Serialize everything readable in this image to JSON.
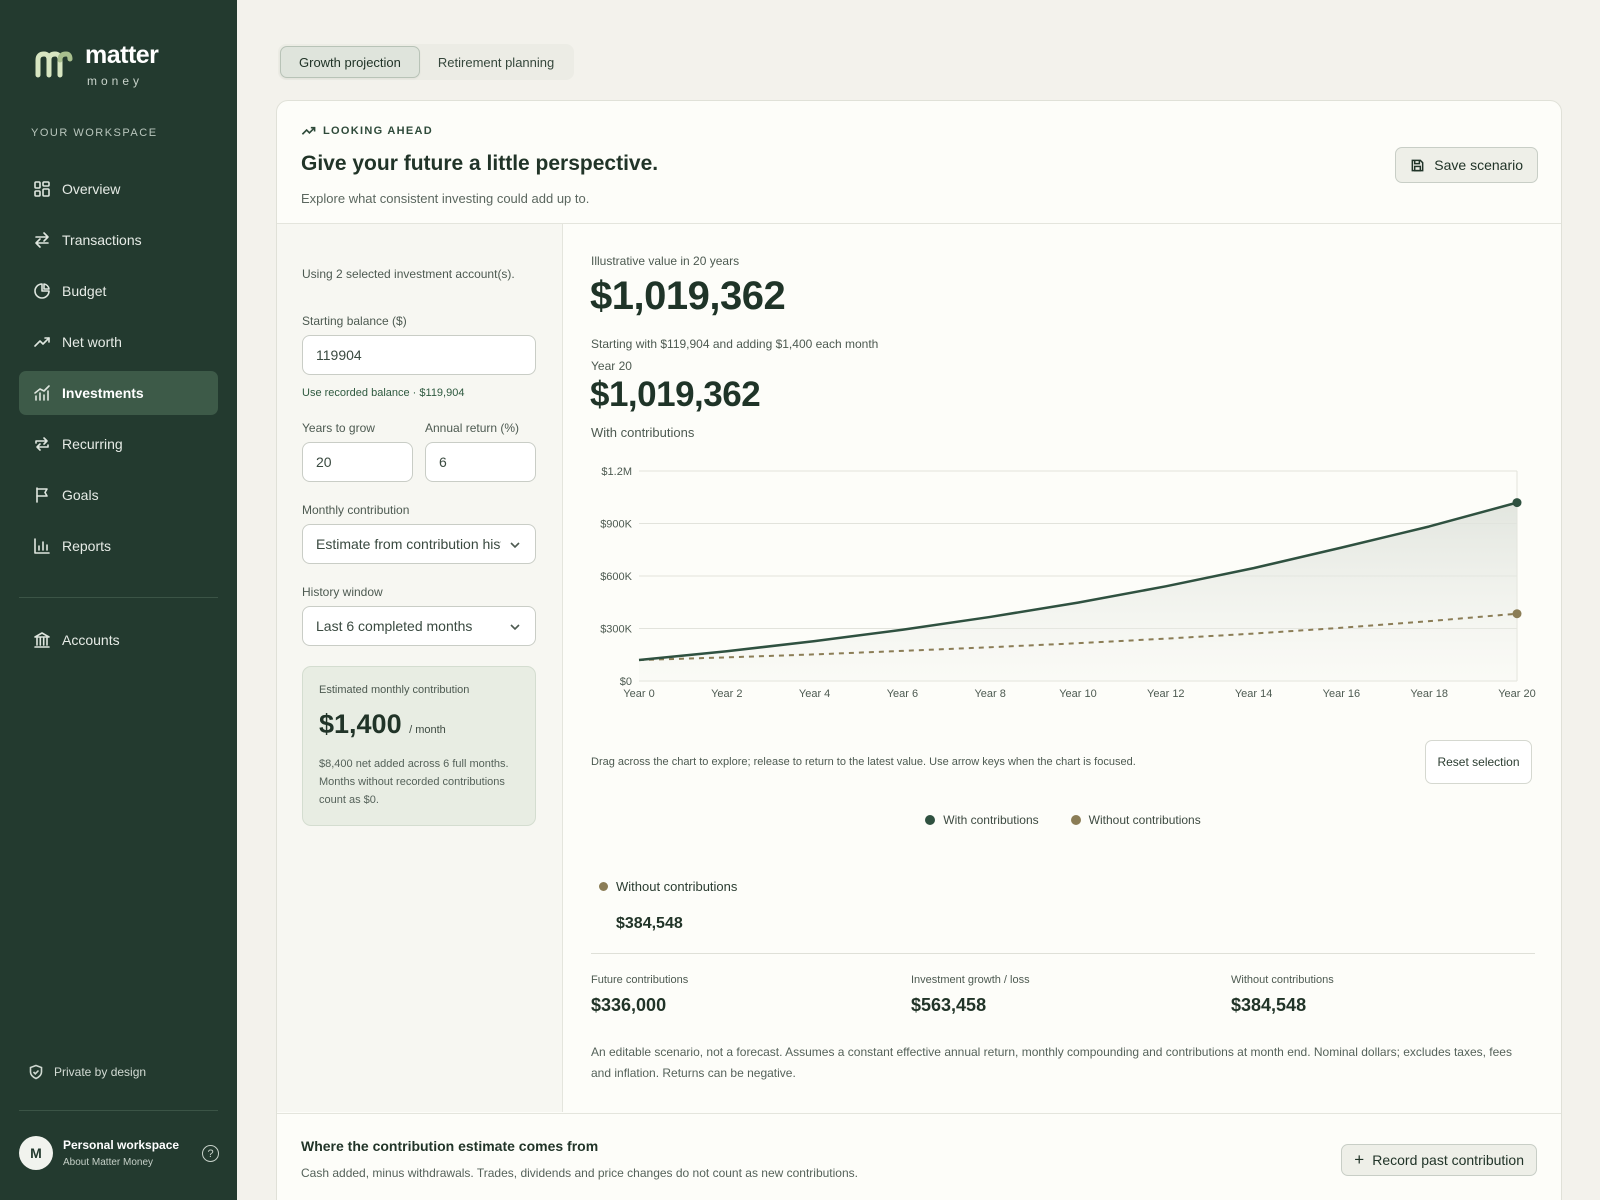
{
  "brand": {
    "name": "matter",
    "sub": "money"
  },
  "sidebar": {
    "workspace_label": "YOUR WORKSPACE",
    "items": [
      {
        "label": "Overview",
        "icon": "grid-icon"
      },
      {
        "label": "Transactions",
        "icon": "arrows-icon"
      },
      {
        "label": "Budget",
        "icon": "pie-icon"
      },
      {
        "label": "Net worth",
        "icon": "trend-icon"
      },
      {
        "label": "Investments",
        "icon": "chart-icon",
        "active": true
      },
      {
        "label": "Recurring",
        "icon": "repeat-icon"
      },
      {
        "label": "Goals",
        "icon": "flag-icon"
      },
      {
        "label": "Reports",
        "icon": "bar-icon"
      }
    ],
    "accounts_label": "Accounts",
    "private_label": "Private by design",
    "profile": {
      "initial": "M",
      "name": "Personal workspace",
      "sub": "About Matter Money"
    }
  },
  "tabs": [
    {
      "label": "Growth projection",
      "active": true
    },
    {
      "label": "Retirement planning",
      "active": false
    }
  ],
  "header": {
    "eyebrow": "LOOKING AHEAD",
    "title": "Give your future a little perspective.",
    "subtitle": "Explore what consistent investing could add up to.",
    "save_label": "Save scenario"
  },
  "form": {
    "accounts_note": "Using 2 selected investment account(s).",
    "starting_balance_label": "Starting balance ($)",
    "starting_balance_value": "119904",
    "recorded_balance_link": "Use recorded balance · $119,904",
    "years_label": "Years to grow",
    "years_value": "20",
    "return_label": "Annual return (%)",
    "return_value": "6",
    "contribution_label": "Monthly contribution",
    "contribution_value": "Estimate from contribution history",
    "history_label": "History window",
    "history_value": "Last 6 completed months",
    "estimate": {
      "label": "Estimated monthly contribution",
      "value": "$1,400",
      "unit": "/ month",
      "note": "$8,400 net added across 6 full months. Months without recorded contributions count as $0."
    }
  },
  "results": {
    "illustrative_label": "Illustrative value in 20 years",
    "illustrative_value": "$1,019,362",
    "illustrative_note": "Starting with $119,904 and adding $1,400 each month",
    "year_label": "Year 20",
    "year_value": "$1,019,362",
    "year_series": "With contributions",
    "drag_note": "Drag across the chart to explore; release to return to the latest value. Use arrow keys when the chart is focused.",
    "reset_label": "Reset selection",
    "legend_with": "With contributions",
    "legend_without": "Without contributions",
    "without_label": "Without contributions",
    "without_value": "$384,548",
    "stats": [
      {
        "label": "Future contributions",
        "value": "$336,000"
      },
      {
        "label": "Investment growth / loss",
        "value": "$563,458"
      },
      {
        "label": "Without contributions",
        "value": "$384,548"
      }
    ],
    "disclaimer": "An editable scenario, not a forecast. Assumes a constant effective annual return, monthly compounding and contributions at month end. Nominal dollars; excludes taxes, fees and inflation. Returns can be negative."
  },
  "bottom": {
    "title": "Where the contribution estimate comes from",
    "subtitle": "Cash added, minus withdrawals. Trades, dividends and price changes do not count as new contributions.",
    "record_label": "Record past contribution"
  },
  "colors": {
    "with": "#2f5140",
    "without": "#8b7d56",
    "sidebar": "#233a2f"
  },
  "chart_data": {
    "type": "line",
    "x": [
      0,
      2,
      4,
      6,
      8,
      10,
      12,
      14,
      16,
      18,
      20
    ],
    "xlabels": [
      "Year 0",
      "Year 2",
      "Year 4",
      "Year 6",
      "Year 8",
      "Year 10",
      "Year 12",
      "Year 14",
      "Year 16",
      "Year 18",
      "Year 20"
    ],
    "series": [
      {
        "name": "With contributions",
        "values": [
          119904,
          170000,
          228000,
          293000,
          366000,
          448000,
          541000,
          645000,
          762000,
          883000,
          1019362
        ]
      },
      {
        "name": "Without contributions",
        "values": [
          119904,
          135000,
          152000,
          172000,
          193000,
          216000,
          242000,
          271000,
          304000,
          342000,
          384548
        ]
      }
    ],
    "yticks": [
      "$0",
      "$300K",
      "$600K",
      "$900K",
      "$1.2M"
    ],
    "ylim": [
      0,
      1200000
    ],
    "grid": true
  }
}
